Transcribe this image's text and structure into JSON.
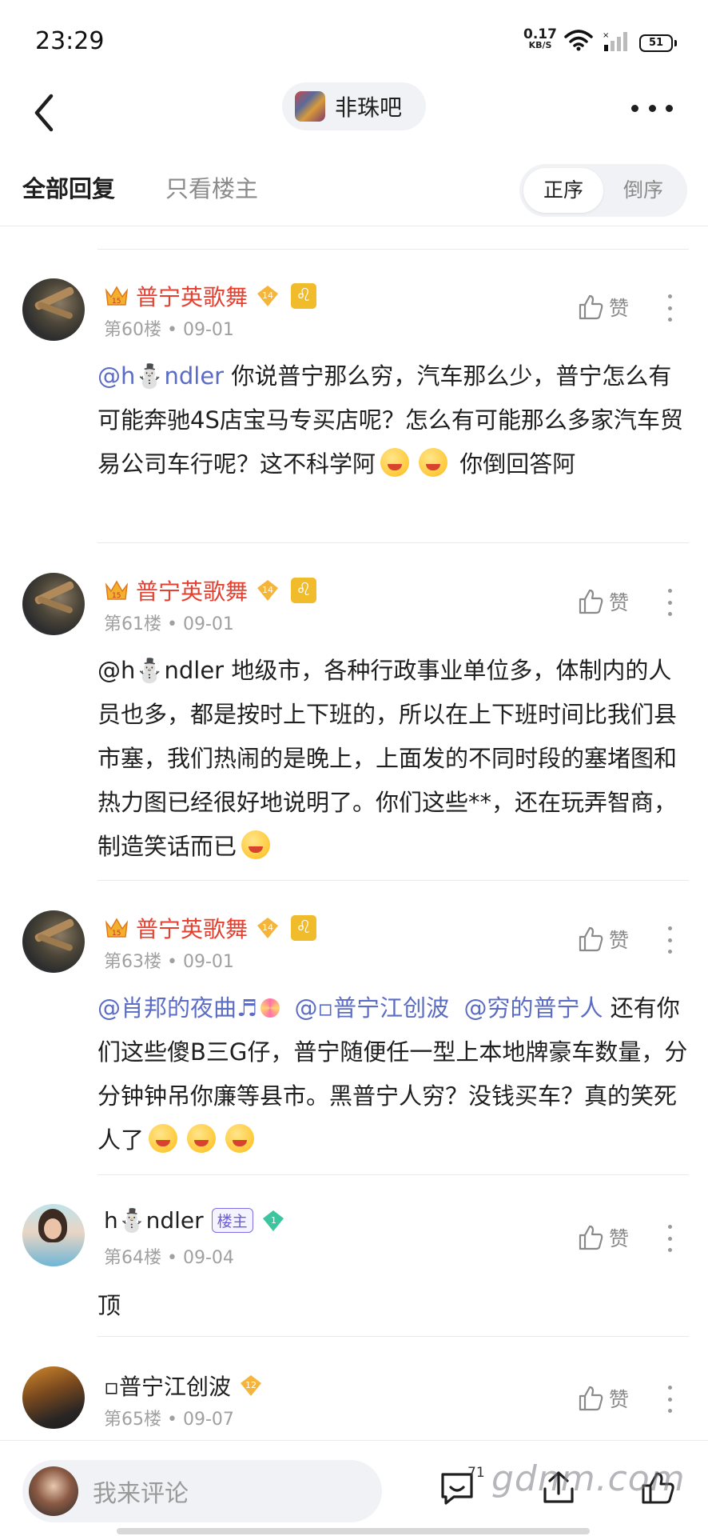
{
  "status": {
    "time": "23:29",
    "net_speed": "0.17",
    "net_unit": "KB/S",
    "battery": "51"
  },
  "nav": {
    "forum_name": "非珠吧"
  },
  "tabs": {
    "all": "全部回复",
    "owner_only": "只看楼主",
    "sort_asc": "正序",
    "sort_desc": "倒序"
  },
  "like_label": "赞",
  "posts": [
    {
      "user": "普宁英歌舞",
      "level": "14",
      "floor": "第60楼",
      "date": "09-01",
      "mention": "@h⛄ndler",
      "text": " 你说普宁那么穷，汽车那么少，普宁怎么有可能奔驰4S店宝马专买店呢？怎么有可能那么多家汽车贸易公司车行呢？这不科学阿",
      "tail": " 你倒回答阿"
    },
    {
      "user": "普宁英歌舞",
      "level": "14",
      "floor": "第61楼",
      "date": "09-01",
      "text": "@h⛄ndler 地级市，各种行政事业单位多，体制内的人员也多，都是按时上下班的，所以在上下班时间比我们县市塞，我们热闹的是晚上，上面发的不同时段的塞堵图和热力图已经很好地说明了。你们这些**，还在玩弄智商，制造笑话而已"
    },
    {
      "user": "普宁英歌舞",
      "level": "14",
      "floor": "第63楼",
      "date": "09-01",
      "mention1": "@肖邦的夜曲♬",
      "mention2": "@▫普宁江创波",
      "mention3": "@穷的普宁人",
      "text": " 还有你们这些傻B三G仔，普宁随便任一型上本地牌豪车数量，分分钟钟吊你廉等县市。黑普宁人穷？没钱买车？真的笑死人了"
    },
    {
      "user": "h⛄ndler",
      "badge": "楼主",
      "level": "1",
      "floor": "第64楼",
      "date": "09-04",
      "text": "顶"
    },
    {
      "user": "▫普宁江创波",
      "level": "12",
      "floor": "第65楼",
      "date": "09-07"
    }
  ],
  "bottom": {
    "placeholder": "我来评论",
    "comment_count": "71",
    "watermark": "gdnm.com"
  },
  "colors": {
    "username": "#e5402f",
    "mention": "#5b6cc4",
    "level_badge": "#f5b53a",
    "host_badge": "#6a5ce0"
  }
}
